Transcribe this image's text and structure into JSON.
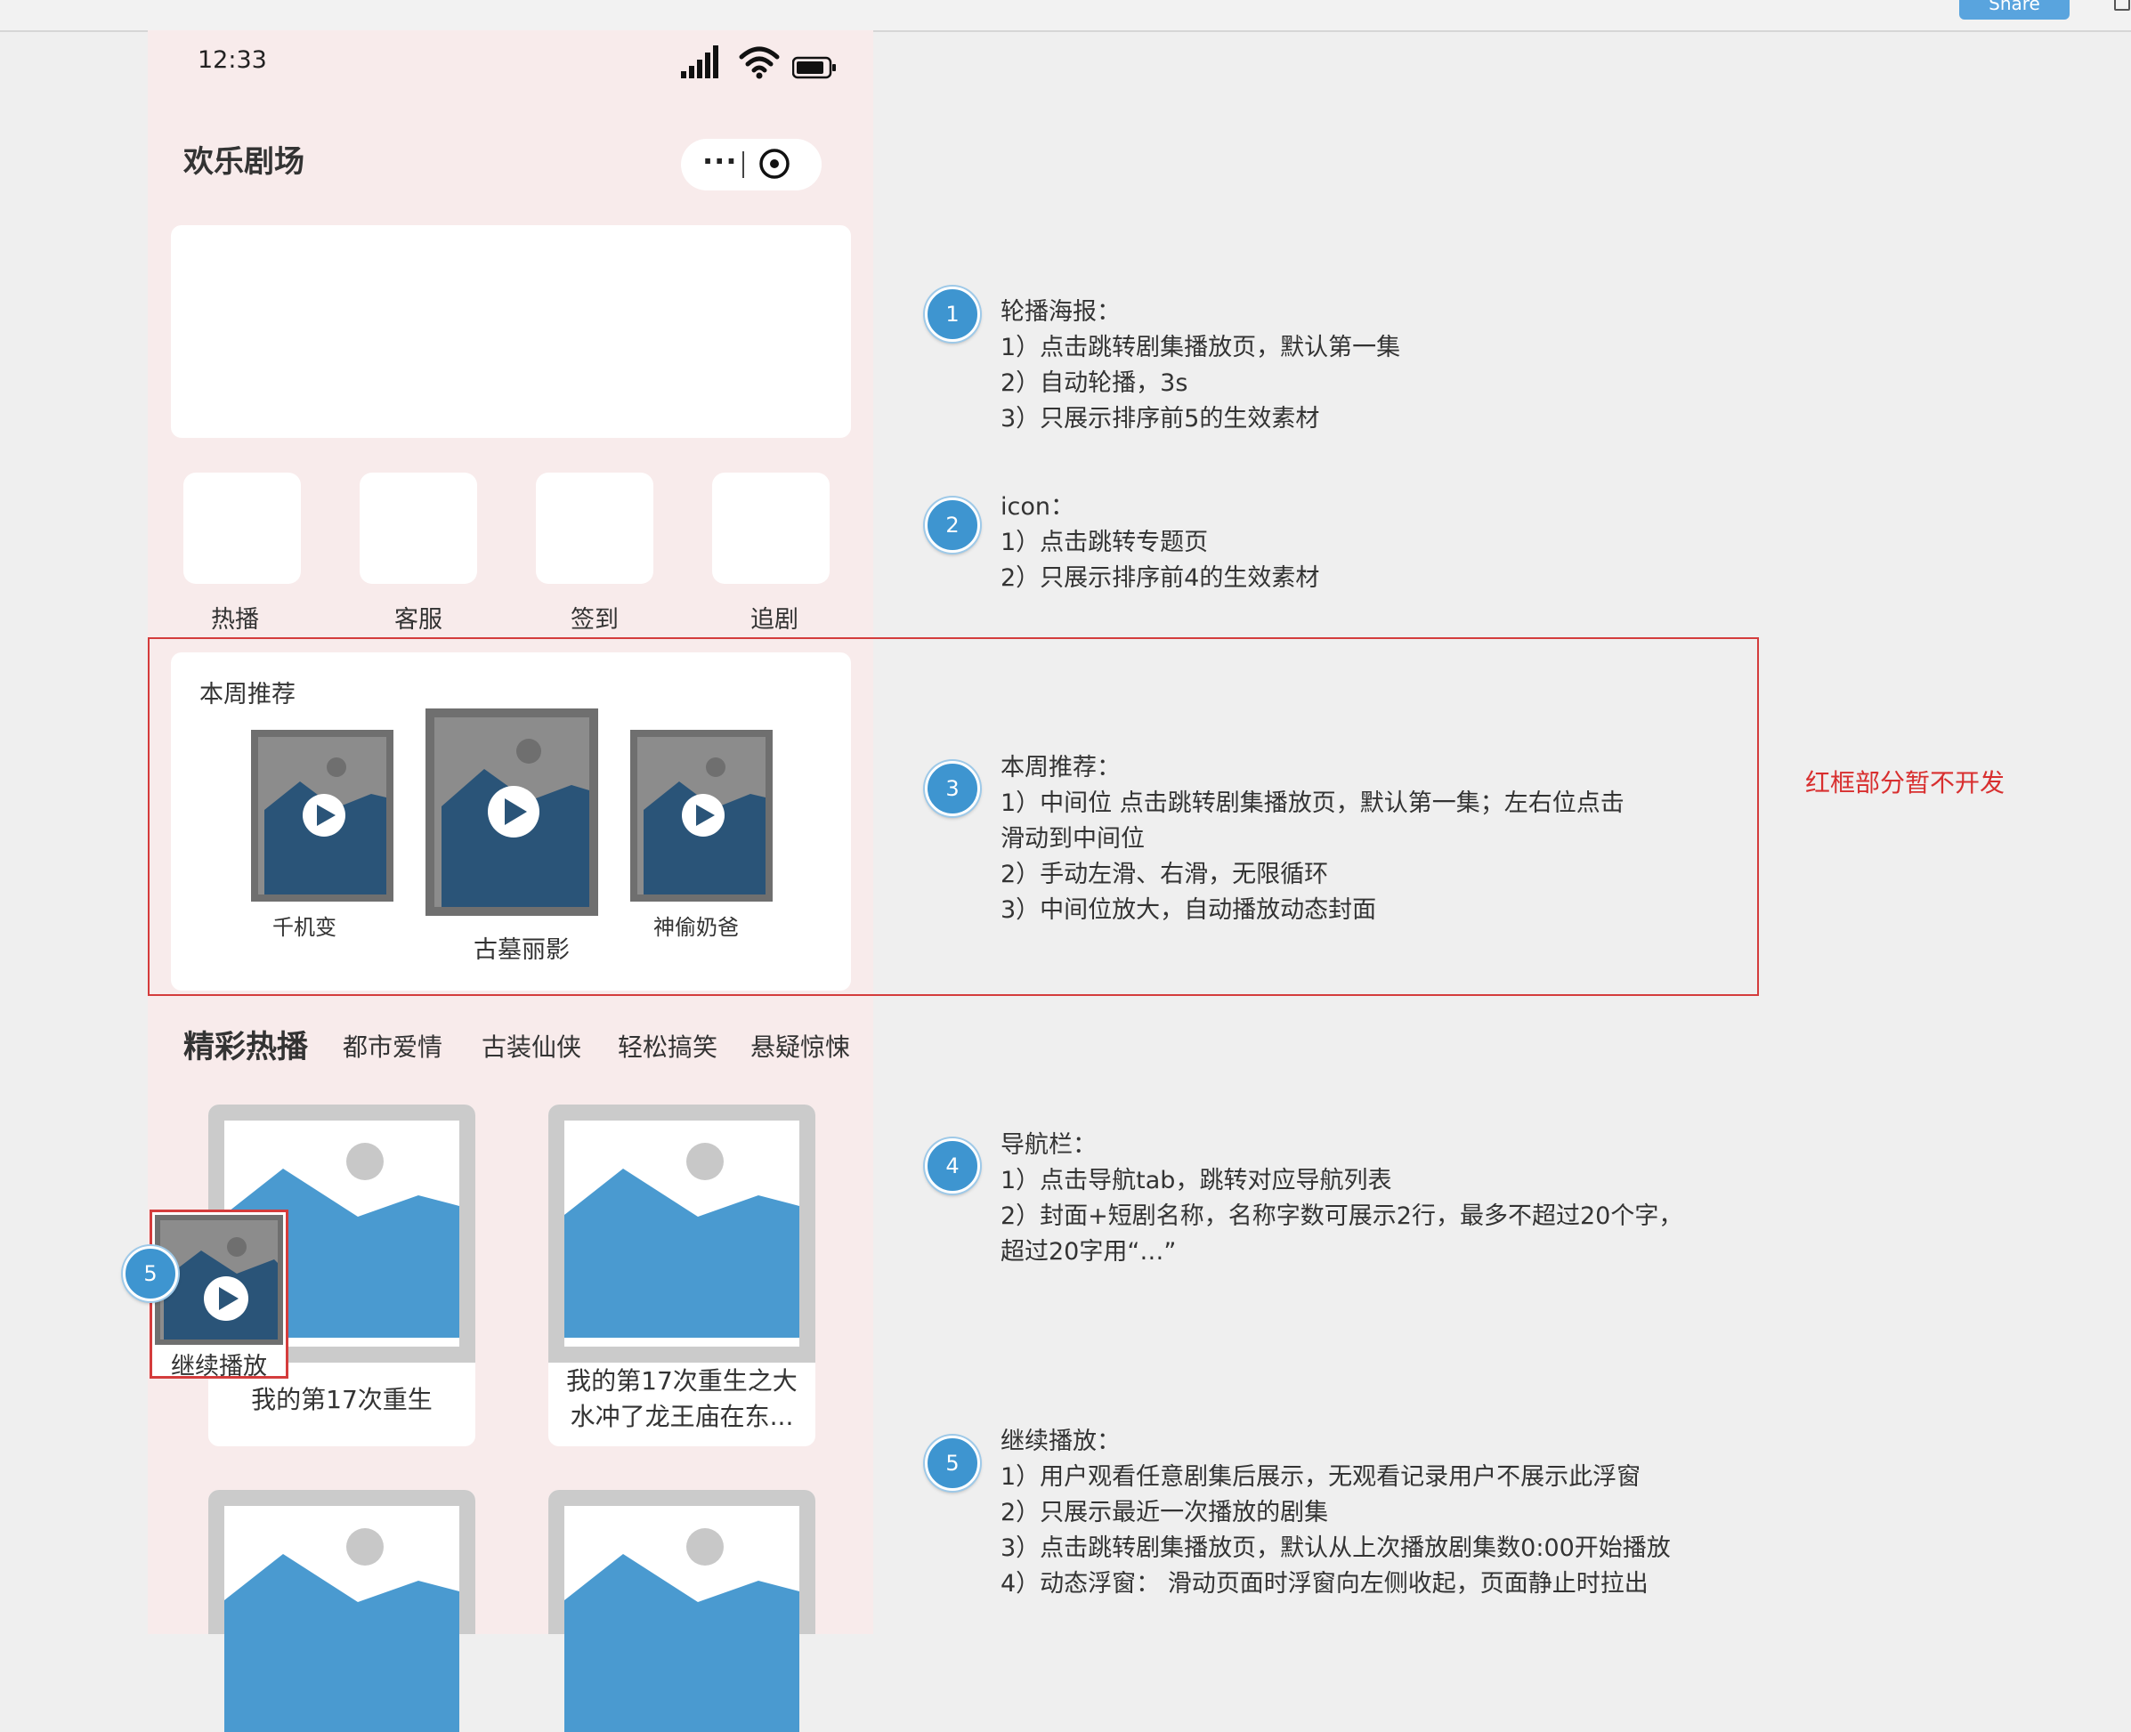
{
  "toolbar": {
    "share_label": "Share"
  },
  "status_bar": {
    "time": "12:33"
  },
  "app": {
    "title": "欢乐剧场",
    "capsule_more": "···"
  },
  "icons": [
    {
      "label": "热播"
    },
    {
      "label": "客服"
    },
    {
      "label": "签到"
    },
    {
      "label": "追剧"
    }
  ],
  "weekly": {
    "title": "本周推荐",
    "items": [
      {
        "label": "千机变"
      },
      {
        "label": "古墓丽影"
      },
      {
        "label": "神偷奶爸"
      }
    ]
  },
  "red_note": "红框部分暂不开发",
  "hot": {
    "title": "精彩热播",
    "tabs": [
      "都市爱情",
      "古装仙侠",
      "轻松搞笑",
      "悬疑惊悚"
    ],
    "cards": [
      {
        "title_line1": "我的第17次重生",
        "title_line2": ""
      },
      {
        "title_line1": "我的第17次重生之大",
        "title_line2": "水冲了龙王庙在东..."
      }
    ]
  },
  "floating": {
    "label": "继续播放"
  },
  "annotations": [
    {
      "num": "1",
      "lines": [
        "轮播海报：",
        "1）点击跳转剧集播放页，默认第一集",
        "2）自动轮播，3s",
        "3）只展示排序前5的生效素材"
      ]
    },
    {
      "num": "2",
      "lines": [
        "icon：",
        "1）点击跳转专题页",
        "2）只展示排序前4的生效素材"
      ]
    },
    {
      "num": "3",
      "lines": [
        "本周推荐：",
        "1）中间位 点击跳转剧集播放页，默认第一集；左右位点击",
        "滑动到中间位",
        "2）手动左滑、右滑，无限循环",
        "3）中间位放大，自动播放动态封面"
      ]
    },
    {
      "num": "4",
      "lines": [
        "导航栏：",
        "1）点击导航tab，跳转对应导航列表",
        "2）封面+短剧名称，名称字数可展示2行，最多不超过20个字，",
        "超过20字用“…”"
      ]
    },
    {
      "num": "5",
      "lines": [
        "继续播放：",
        "1）用户观看任意剧集后展示，无观看记录用户不展示此浮窗",
        "2）只展示最近一次播放的剧集",
        "3）点击跳转剧集播放页，默认从上次播放剧集数0:00开始播放",
        "4）动态浮窗： 滑动页面时浮窗向左侧收起，页面静止时拉出"
      ]
    }
  ],
  "floating_badge": "5"
}
